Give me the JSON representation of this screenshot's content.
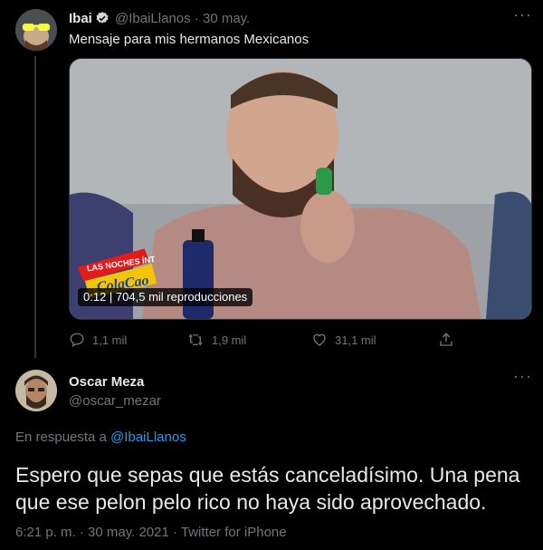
{
  "tweet1": {
    "author_name": "Ibai",
    "handle": "@IbaiLlanos",
    "date_separator": "·",
    "date": "30 may.",
    "text": "Mensaje para mis hermanos Mexicanos",
    "video": {
      "time": "0:12",
      "views": "704,5 mil reproducciones",
      "logo_text": "LAS NOCHES ÍNTIMAS ColaCao"
    },
    "actions": {
      "reply_count": "1,1 mil",
      "retweet_count": "1,9 mil",
      "like_count": "31,1 mil"
    }
  },
  "tweet2": {
    "author_name": "Oscar Meza",
    "handle": "@oscar_mezar",
    "reply_prefix": "En respuesta a",
    "reply_handle": "@IbaiLlanos",
    "text": "Espero que sepas que estás canceladísimo. Una pena que ese pelon pelo rico no haya sido aprovechado.",
    "timestamp": "6:21 p. m. · 30 may. 2021 · Twitter for iPhone"
  },
  "colors": {
    "background": "#000000",
    "text_primary": "#e7e9ea",
    "text_muted": "#71767b",
    "link": "#1d9bf0",
    "divider": "#2f3336"
  },
  "icons": [
    "verified-badge-icon",
    "more-icon",
    "reply-icon",
    "retweet-icon",
    "like-icon",
    "share-icon"
  ]
}
